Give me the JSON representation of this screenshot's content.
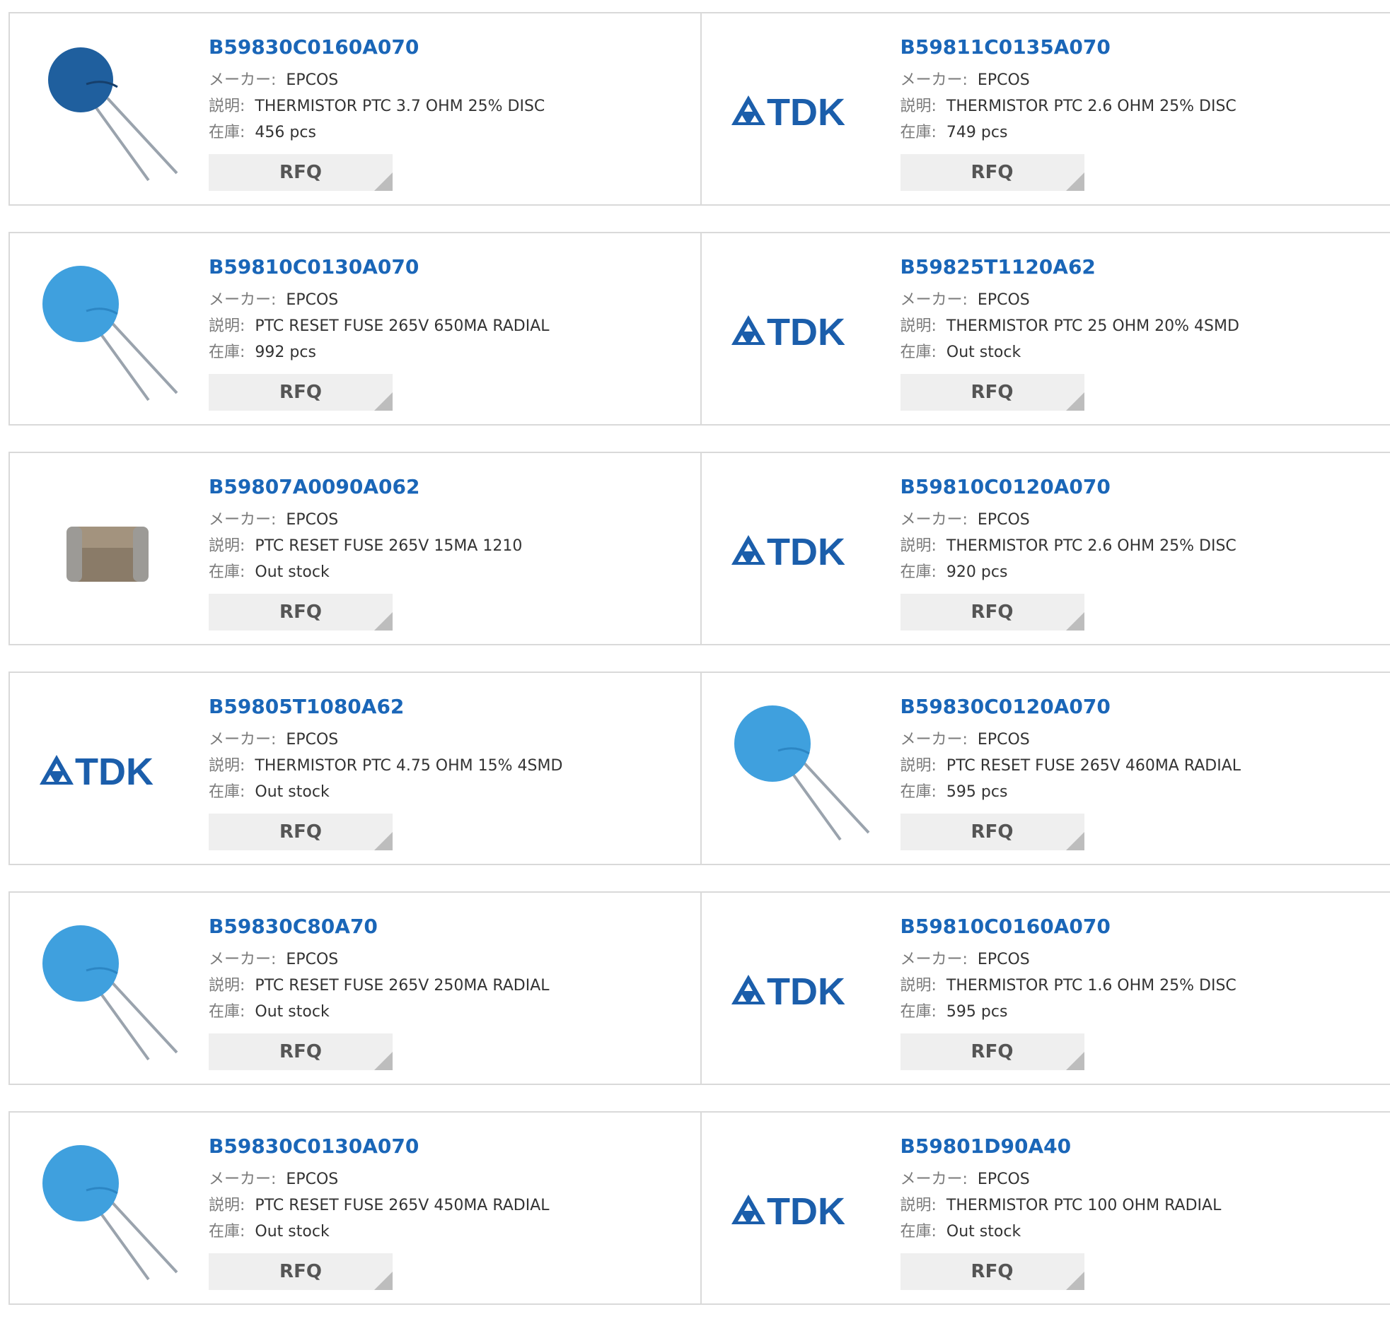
{
  "labels": {
    "maker": "メーカー:",
    "description": "説明:",
    "stock": "在庫:",
    "rfq": "RFQ"
  },
  "colors": {
    "link": "#1a66b8",
    "tdk_logo": "#1b5eab",
    "disc": "#3fa0de",
    "disc_dark": "#1f5f9e",
    "border": "#d9d9d9",
    "button_bg": "#efefef"
  },
  "logo_text": "TDK",
  "rows": [
    [
      {
        "part_number": "B59830C0160A070",
        "maker": "EPCOS",
        "description": "THERMISTOR PTC 3.7 OHM 25% DISC",
        "stock": "456 pcs",
        "image": "disc-dark"
      },
      {
        "part_number": "B59811C0135A070",
        "maker": "EPCOS",
        "description": "THERMISTOR PTC 2.6 OHM 25% DISC",
        "stock": "749 pcs",
        "image": "tdk-logo"
      }
    ],
    [
      {
        "part_number": "B59810C0130A070",
        "maker": "EPCOS",
        "description": "PTC RESET FUSE 265V 650MA RADIAL",
        "stock": "992 pcs",
        "image": "disc-light"
      },
      {
        "part_number": "B59825T1120A62",
        "maker": "EPCOS",
        "description": "THERMISTOR PTC 25 OHM 20% 4SMD",
        "stock": "Out stock",
        "image": "tdk-logo"
      }
    ],
    [
      {
        "part_number": "B59807A0090A062",
        "maker": "EPCOS",
        "description": "PTC RESET FUSE 265V 15MA 1210",
        "stock": "Out stock",
        "image": "smd-chip"
      },
      {
        "part_number": "B59810C0120A070",
        "maker": "EPCOS",
        "description": "THERMISTOR PTC 2.6 OHM 25% DISC",
        "stock": "920 pcs",
        "image": "tdk-logo"
      }
    ],
    [
      {
        "part_number": "B59805T1080A62",
        "maker": "EPCOS",
        "description": "THERMISTOR PTC 4.75 OHM 15% 4SMD",
        "stock": "Out stock",
        "image": "tdk-logo"
      },
      {
        "part_number": "B59830C0120A070",
        "maker": "EPCOS",
        "description": "PTC RESET FUSE 265V 460MA RADIAL",
        "stock": "595 pcs",
        "image": "disc-light"
      }
    ],
    [
      {
        "part_number": "B59830C80A70",
        "maker": "EPCOS",
        "description": "PTC RESET FUSE 265V 250MA RADIAL",
        "stock": "Out stock",
        "image": "disc-light"
      },
      {
        "part_number": "B59810C0160A070",
        "maker": "EPCOS",
        "description": "THERMISTOR PTC 1.6 OHM 25% DISC",
        "stock": "595 pcs",
        "image": "tdk-logo"
      }
    ],
    [
      {
        "part_number": "B59830C0130A070",
        "maker": "EPCOS",
        "description": "PTC RESET FUSE 265V 450MA RADIAL",
        "stock": "Out stock",
        "image": "disc-light"
      },
      {
        "part_number": "B59801D90A40",
        "maker": "EPCOS",
        "description": "THERMISTOR PTC 100 OHM RADIAL",
        "stock": "Out stock",
        "image": "tdk-logo"
      }
    ]
  ]
}
